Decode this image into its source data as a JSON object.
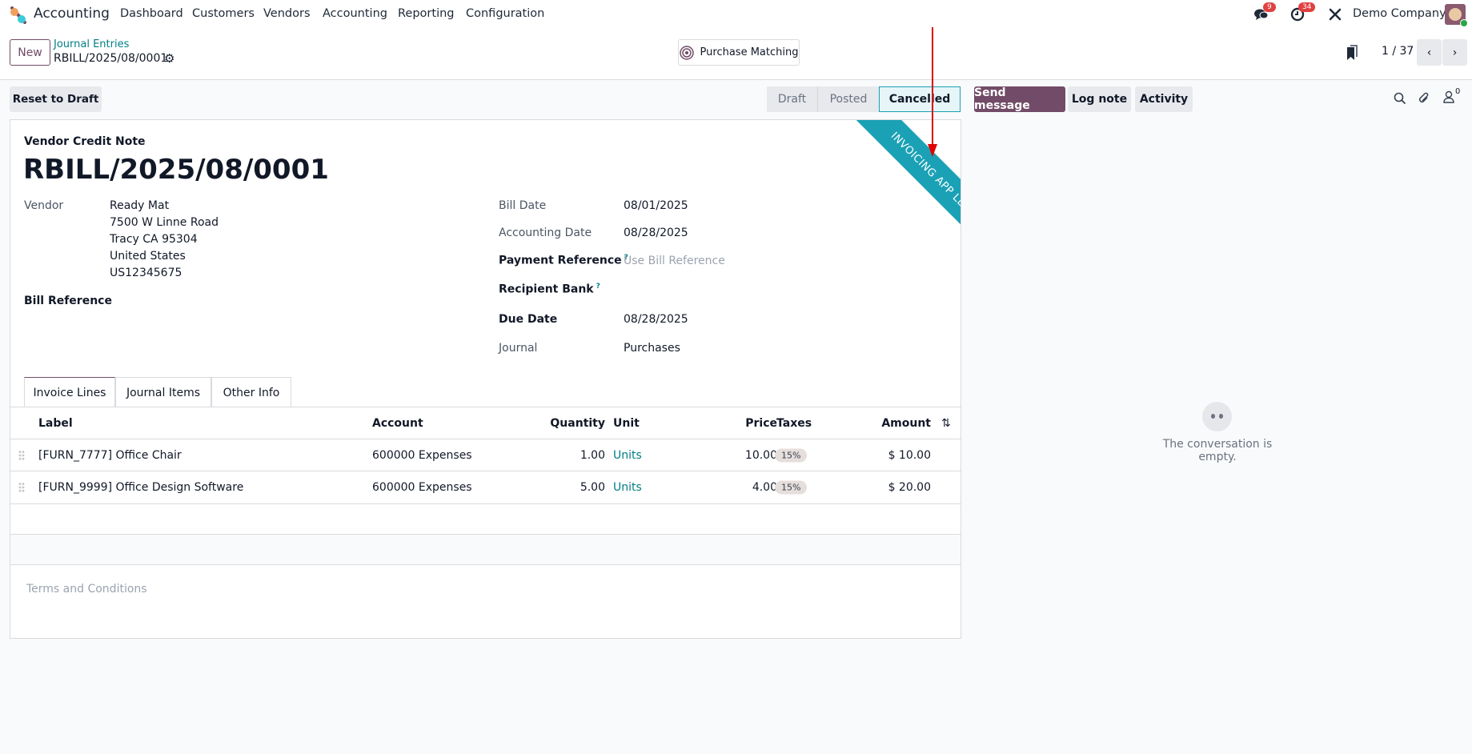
{
  "nav": {
    "app_name": "Accounting",
    "menu": [
      "Dashboard",
      "Customers",
      "Vendors",
      "Accounting",
      "Reporting",
      "Configuration"
    ],
    "messages_badge": "9",
    "activities_badge": "34",
    "company": "Demo Company"
  },
  "control_panel": {
    "new_label": "New",
    "breadcrumb_parent": "Journal Entries",
    "breadcrumb_current": "RBILL/2025/08/0001",
    "purchase_matching_label": "Purchase Matching",
    "pager": "1 / 37"
  },
  "statusbar": {
    "reset_label": "Reset to Draft",
    "stages": [
      "Draft",
      "Posted",
      "Cancelled"
    ],
    "active_stage": "Cancelled"
  },
  "chatter": {
    "send_message": "Send message",
    "log_note": "Log note",
    "activity": "Activity",
    "followers_count": "0",
    "empty_text": "The conversation is empty."
  },
  "form": {
    "ribbon": "INVOICING APP LEGACY",
    "ribbon_color": "#1ba1b5",
    "move_type": "Vendor Credit Note",
    "name": "RBILL/2025/08/0001",
    "vendor_label": "Vendor",
    "vendor_name": "Ready Mat",
    "vendor_address": [
      "7500 W Linne Road",
      "Tracy CA 95304",
      "United States",
      "US12345675"
    ],
    "bill_reference_label": "Bill Reference",
    "bill_date_label": "Bill Date",
    "bill_date": "08/01/2025",
    "accounting_date_label": "Accounting Date",
    "accounting_date": "08/28/2025",
    "payment_reference_label": "Payment Reference",
    "payment_reference_placeholder": "Use Bill Reference",
    "recipient_bank_label": "Recipient Bank",
    "due_date_label": "Due Date",
    "due_date": "08/28/2025",
    "journal_label": "Journal",
    "journal": "Purchases",
    "help_mark": "?"
  },
  "tabs": [
    "Invoice Lines",
    "Journal Items",
    "Other Info"
  ],
  "lines": {
    "headers": {
      "label": "Label",
      "account": "Account",
      "quantity": "Quantity",
      "unit": "Unit",
      "price": "Price",
      "taxes": "Taxes",
      "amount": "Amount"
    },
    "rows": [
      {
        "label": "[FURN_7777] Office Chair",
        "account": "600000 Expenses",
        "quantity": "1.00",
        "unit": "Units",
        "price": "10.00",
        "taxes": "15%",
        "amount": "$ 10.00"
      },
      {
        "label": "[FURN_9999] Office Design Software",
        "account": "600000 Expenses",
        "quantity": "5.00",
        "unit": "Units",
        "price": "4.00",
        "taxes": "15%",
        "amount": "$ 20.00"
      }
    ],
    "terms_placeholder": "Terms and Conditions"
  }
}
